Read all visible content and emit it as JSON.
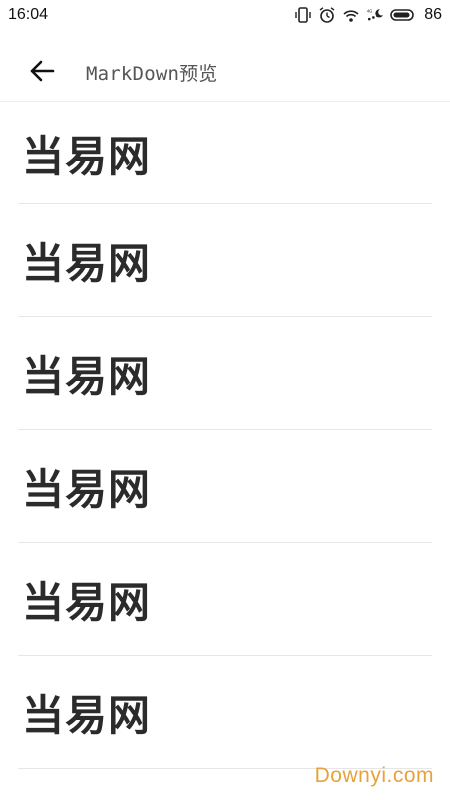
{
  "status_bar": {
    "time": "16:04",
    "battery_level": "86",
    "network_label": "4G",
    "icons": [
      "vibrate-icon",
      "alarm-icon",
      "wifi-icon",
      "signal-icon",
      "battery-icon"
    ]
  },
  "app_bar": {
    "back_icon": "arrow-left-icon",
    "title": "MarkDown预览"
  },
  "content": {
    "headings": [
      "当易网",
      "当易网",
      "当易网",
      "当易网",
      "当易网",
      "当易网"
    ]
  },
  "watermark": "Downyi.com",
  "colors": {
    "accent_watermark": "#e8a23a",
    "text_primary": "#2b2b2b",
    "divider": "#e6e6e6"
  }
}
